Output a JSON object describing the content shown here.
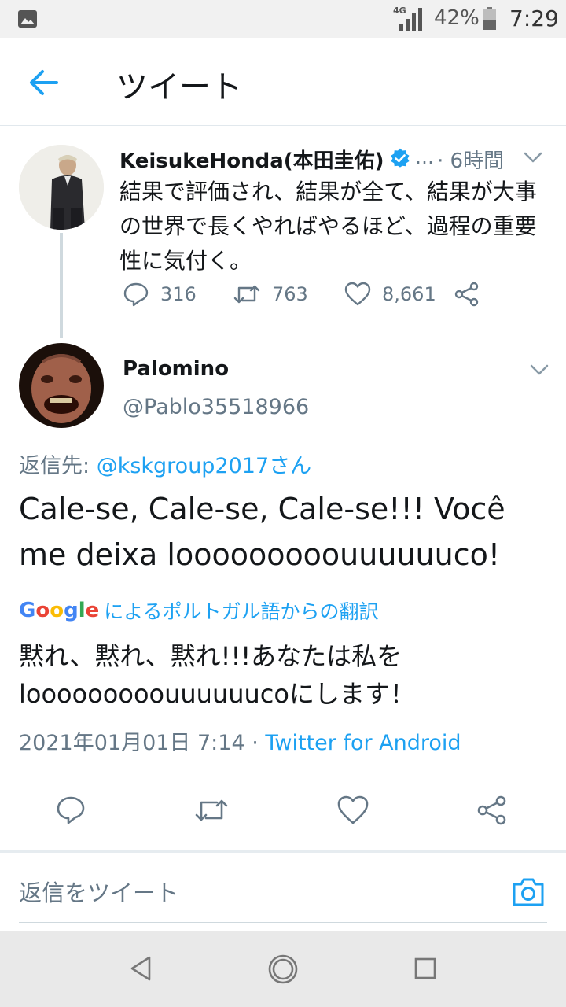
{
  "status_bar": {
    "network": "4G",
    "battery": "42%",
    "time": "7:29"
  },
  "header": {
    "title": "ツイート"
  },
  "parent_tweet": {
    "name": "KeisukeHonda(本田圭佑)",
    "ellipsis": "…",
    "time": "· 6時間",
    "text": "結果で評価され、結果が全て、結果が大事の世界で長くやればやるほど、過程の重要性に気付く。",
    "replies": "316",
    "retweets": "763",
    "likes": "8,661"
  },
  "tweet": {
    "name": "Palomino",
    "handle": "@Pablo35518966",
    "replying_prefix": "返信先: ",
    "replying_to": "@kskgroup2017さん",
    "text": "Cale-se, Cale-se, Cale-se!!! Você me deixa looooooooouuuuuuco!",
    "translate_brand": "Google",
    "translate_label": "によるポルトガル語からの翻訳",
    "translation": "黙れ、黙れ、黙れ!!!あなたは私をlooooooooouuuuuucoにします！",
    "datetime": "2021年01月01日 7:14 · ",
    "client": "Twitter for Android"
  },
  "compose": {
    "placeholder": "返信をツイート"
  },
  "colors": {
    "accent": "#1da1f2",
    "secondary_text": "#657786",
    "divider": "#e1e8ed"
  }
}
